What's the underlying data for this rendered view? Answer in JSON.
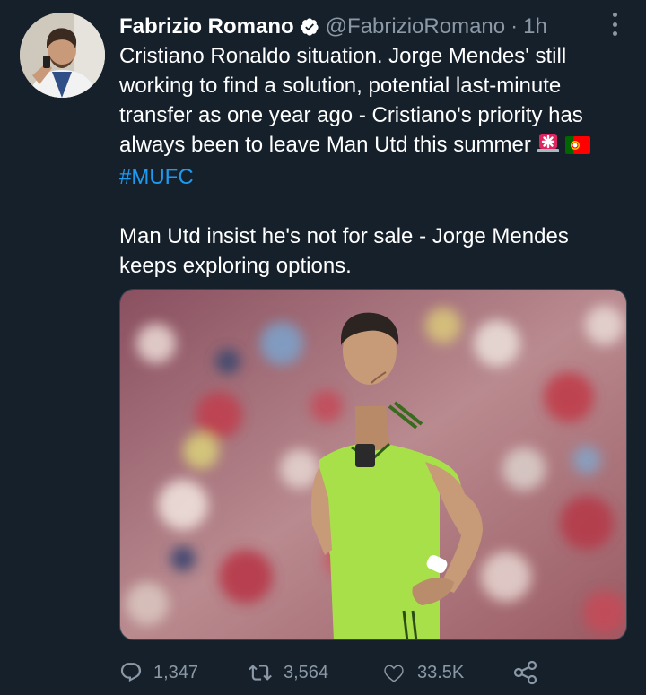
{
  "tweet": {
    "author_name": "Fabrizio Romano",
    "author_handle": "@FabrizioRomano",
    "separator": "·",
    "time": "1h",
    "text_line_1": "Cristiano Ronaldo situation. Jorge Mendes' still working to find a solution, potential last-minute transfer as one year ago - Cristiano's priority has always been to leave Man Utd this summer",
    "hashtag": "#MUFC",
    "text_line_2": "Man Utd insist he's not for sale - Jorge Mendes keeps exploring options.",
    "emojis": [
      "rotating-light-emoji",
      "portugal-flag-emoji"
    ]
  },
  "actions": {
    "replies": "1,347",
    "retweets": "3,564",
    "likes": "33.5K"
  },
  "icons": [
    "verified-badge-icon",
    "more-options-icon",
    "reply-icon",
    "retweet-icon",
    "like-icon",
    "share-icon"
  ],
  "colors": {
    "background": "#15202b",
    "text_primary": "#ffffff",
    "text_secondary": "#8b98a5",
    "accent": "#1d9bf0"
  }
}
